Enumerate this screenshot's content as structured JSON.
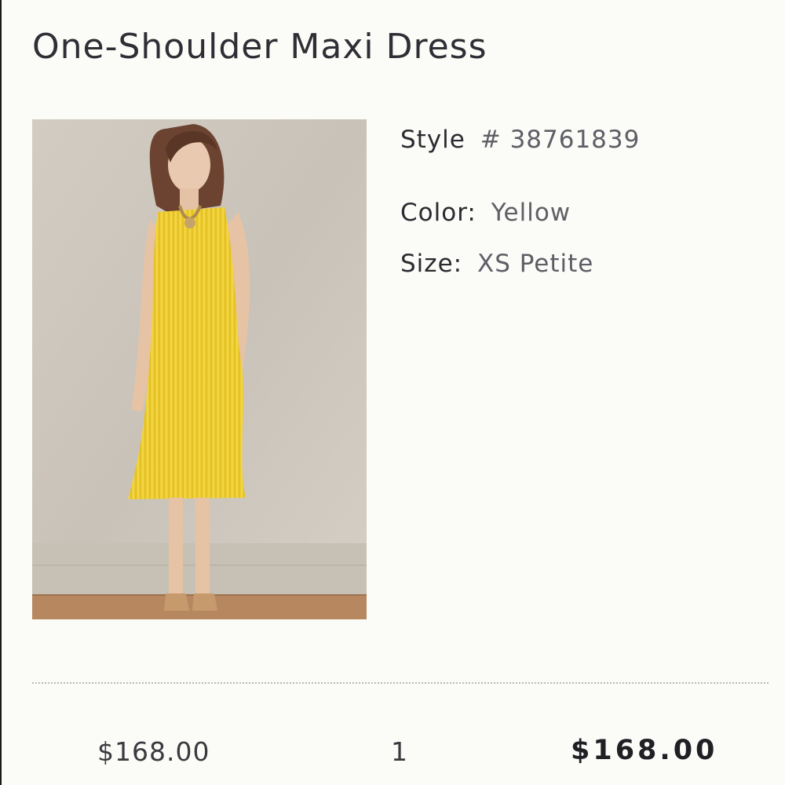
{
  "product": {
    "title": "One-Shoulder Maxi Dress",
    "style_label": "Style",
    "style_value": "# 38761839",
    "color_label": "Color:",
    "color_value": "Yellow",
    "size_label": "Size:",
    "size_value": "XS Petite",
    "image_alt": "model-in-yellow-pleated-dress-photo"
  },
  "line_item": {
    "unit_price": "$168.00",
    "quantity": "1",
    "total": "$168.00"
  },
  "colors": {
    "dress_yellow": "#f0d23a",
    "background": "#fbfbf7",
    "wall": "#cfc8bd",
    "floor": "#b98a63"
  }
}
